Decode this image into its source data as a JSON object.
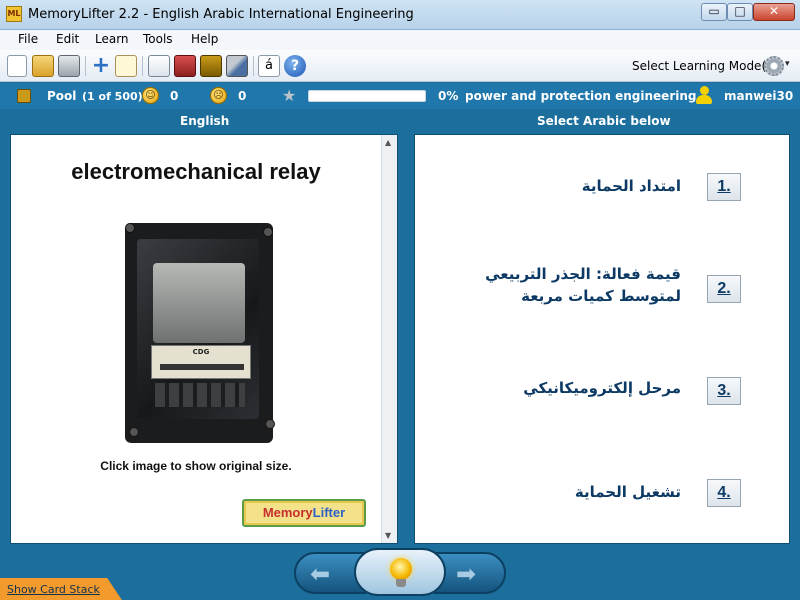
{
  "window": {
    "app_icon_text": "ML",
    "title": "MemoryLifter 2.2 - English Arabic International Engineering",
    "minimize": "▭",
    "maximize": "□",
    "close": "✕"
  },
  "menu": [
    "File",
    "Edit",
    "Learn",
    "Tools",
    "Help"
  ],
  "toolbar": {
    "icons": [
      "new-file-icon",
      "open-folder-icon",
      "print-icon",
      "add-icon",
      "edit-icon",
      "presentation-icon",
      "book-icon",
      "dictionary-icon",
      "tools-icon",
      "accent-character-icon",
      "help-icon"
    ],
    "accent_glyph": "á",
    "help_glyph": "?",
    "mode_label": "Select Learning Mode(s)",
    "mode_arrow": "▾"
  },
  "status": {
    "pool_label": "Pool",
    "pool_count": "(1 of 500)",
    "happy_count": "0",
    "sad_count": "0",
    "progress_text": "0%",
    "progress_value": 0,
    "chapter": "power and protection engineering",
    "user": "manwei30"
  },
  "question": {
    "header": "English",
    "word": "electromechanical relay",
    "image_plate_text": "CDG",
    "image_caption": "Click image to show original size.",
    "logo_part1": "Memory",
    "logo_part2": "Lifter"
  },
  "answers": {
    "header": "Select Arabic below",
    "items": [
      {
        "number": "1.",
        "text": "امتداد الحماية"
      },
      {
        "number": "2.",
        "text": "قيمة فعالة: الجذر التربيعي لمتوسط كميات مربعة"
      },
      {
        "number": "3.",
        "text": "مرحل إلكتروميكانيكي"
      },
      {
        "number": "4.",
        "text": "تشغيل الحماية"
      }
    ]
  },
  "navigation": {
    "back_arrow": "⬅",
    "forward_arrow": "➡"
  },
  "footer": {
    "card_stack": "Show Card Stack"
  },
  "colors": {
    "frame_blue": "#1c6e9c",
    "answer_text": "#0d3a64",
    "card_stack_orange": "#f39a2c"
  }
}
